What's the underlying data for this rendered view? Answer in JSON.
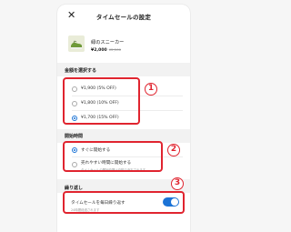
{
  "header": {
    "close_icon": "close-x-icon",
    "title": "タイムセールの設定"
  },
  "product": {
    "name": "緑のスニーカー",
    "price": "¥2,000",
    "original_price": "¥2,500"
  },
  "discount_section": {
    "label": "金額を選択する",
    "options": [
      {
        "label": "¥1,900 (5% OFF)",
        "selected": false
      },
      {
        "label": "¥1,800 (10% OFF)",
        "selected": false
      },
      {
        "label": "¥1,700 (15% OFF)",
        "selected": true
      }
    ]
  },
  "start_section": {
    "label": "開始時間",
    "options": [
      {
        "label": "すぐに開始する",
        "selected": true
      },
      {
        "label": "売れやすい時間に開始する",
        "sublabel": "タイムセールの開始時間は自動で決定されます",
        "selected": false
      }
    ]
  },
  "repeat_section": {
    "label": "繰り返し",
    "toggle_label": "タイムセールを毎日繰り返す",
    "toggle_sublabel": "24時間経過されます",
    "toggle_on": true
  },
  "annotations": [
    "1",
    "2",
    "3"
  ],
  "colors": {
    "accent": "#1b73d6",
    "annotation": "#e0242f"
  }
}
